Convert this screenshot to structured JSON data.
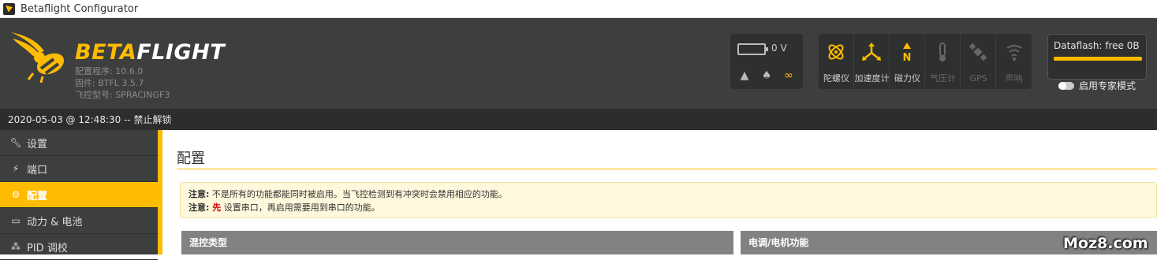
{
  "window": {
    "title": "Betaflight Configurator"
  },
  "header": {
    "logo_beta": "BETA",
    "logo_flight": "FLIGHT",
    "configurator_version": "配置程序: 10.6.0",
    "firmware": "固件: BTFL 3.5.7",
    "target": "飞控型号: SPRACINGF3",
    "battery_voltage": "0 V",
    "sensors": [
      {
        "icon": "gyro-icon",
        "label": "陀螺仪",
        "active": true
      },
      {
        "icon": "accel-icon",
        "label": "加速度计",
        "active": true
      },
      {
        "icon": "mag-icon",
        "label": "磁力仪",
        "active": true
      },
      {
        "icon": "baro-icon",
        "label": "气压计",
        "active": false
      },
      {
        "icon": "gps-icon",
        "label": "GPS",
        "active": false
      },
      {
        "icon": "sonar-icon",
        "label": "声呐",
        "active": false
      }
    ],
    "dataflash": "Dataflash: free 0B",
    "expert_mode_label": "启用专家模式",
    "expert_mode": false
  },
  "status": {
    "text": "2020-05-03 @ 12:48:30 -- 禁止解锁"
  },
  "sidebar": {
    "items": [
      {
        "icon": "wrench-icon",
        "label": "设置",
        "active": false
      },
      {
        "icon": "plug-icon",
        "label": "端口",
        "active": false
      },
      {
        "icon": "gear-icon",
        "label": "配置",
        "active": true
      },
      {
        "icon": "battery-icon",
        "label": "动力 & 电池",
        "active": false
      },
      {
        "icon": "pid-icon",
        "label": "PID 调校",
        "active": false
      }
    ]
  },
  "main": {
    "title": "配置",
    "notice": {
      "line1_label": "注意:",
      "line1_text": " 不是所有的功能都能同时被启用。当飞控检测到有冲突时会禁用相应的功能。",
      "line2_label": "注意:",
      "line2_red": " 先",
      "line2_text": " 设置串口，再启用需要用到串口的功能。"
    },
    "panels": {
      "mixer": "混控类型",
      "esc": "电调/电机功能"
    }
  },
  "watermark": "Moz8.com",
  "colors": {
    "accent": "#ffbb00",
    "header_bg": "#3d3f3e",
    "notice_bg": "#fff8dc",
    "panel_head": "#828282"
  }
}
